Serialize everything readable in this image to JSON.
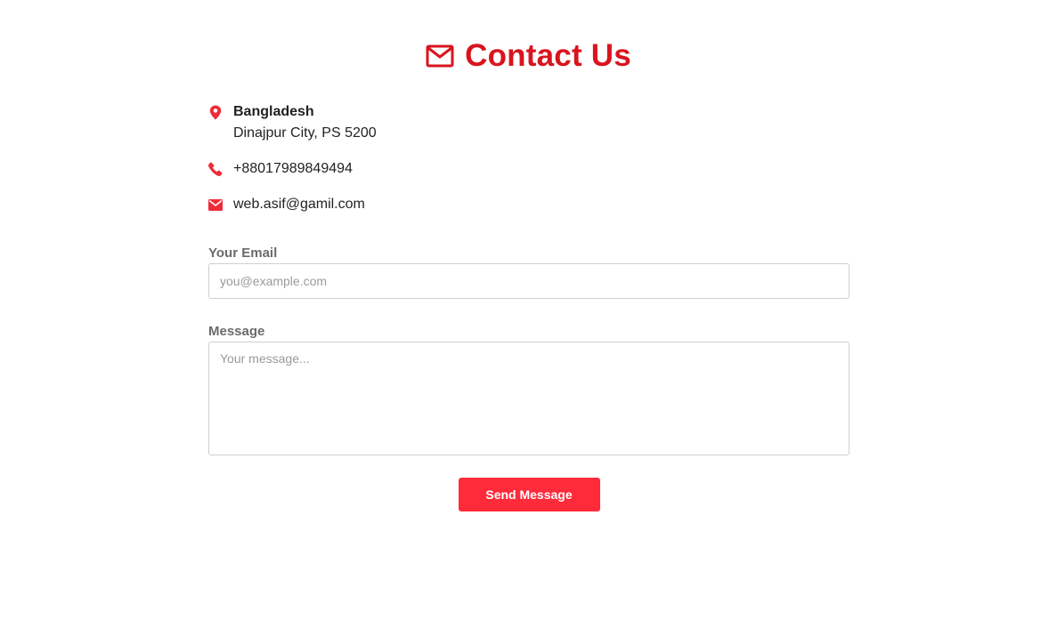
{
  "header": {
    "title": "Contact Us",
    "icon": "envelope-outline-icon",
    "accent_color": "#d9141e"
  },
  "contact_info": {
    "icon_color": "#ef2b3a",
    "location": {
      "icon": "map-pin-icon",
      "country": "Bangladesh",
      "address": "Dinajpur City, PS 5200"
    },
    "phone": {
      "icon": "phone-icon",
      "number": "+88017989849494"
    },
    "email": {
      "icon": "envelope-icon",
      "address": "web.asif@gamil.com"
    }
  },
  "form": {
    "email_label": "Your Email",
    "email_value": "",
    "email_placeholder": "you@example.com",
    "message_label": "Message",
    "message_value": "",
    "message_placeholder": "Your message...",
    "submit_label": "Send Message",
    "submit_color": "#ff2a3a"
  }
}
